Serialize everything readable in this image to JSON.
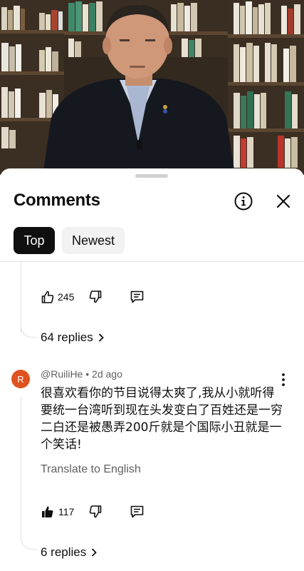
{
  "header": {
    "title": "Comments"
  },
  "icons": {
    "info": "info-icon",
    "close": "close-icon"
  },
  "tabs": [
    {
      "label": "Top",
      "active": true
    },
    {
      "label": "Newest",
      "active": false
    }
  ],
  "comments": [
    {
      "likes": "245",
      "replies": "64 replies"
    },
    {
      "avatar_letter": "R",
      "avatar_color": "#e0521f",
      "author": "@RuiliHe",
      "time": "2d ago",
      "text": "很喜欢看你的节目说得太爽了,我从小就听得要统一台湾听到现在头发变白了百姓还是一穷二白还是被愚弄200斤就是个国际小丑就是一个笑话!",
      "translate": "Translate to English",
      "likes": "117",
      "replies": "6 replies"
    }
  ]
}
